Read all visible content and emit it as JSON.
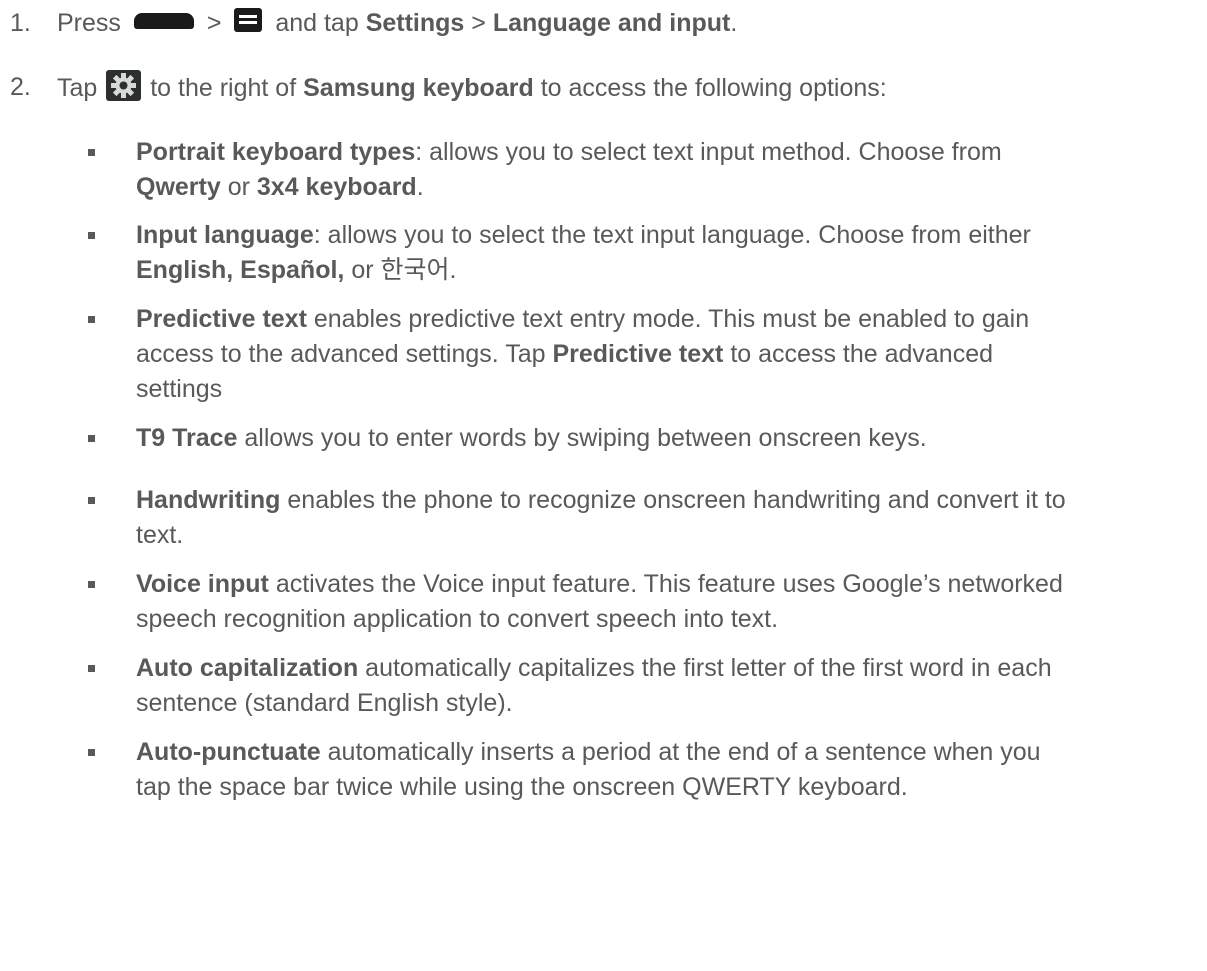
{
  "steps": [
    {
      "number": "1.",
      "pre": "Press",
      "sep": ">",
      "mid": "and tap",
      "b1": "Settings",
      "sep2": ">",
      "b2": "Language and input",
      "end": ".",
      "icons": [
        "home-key-icon",
        "menu-key-icon"
      ]
    },
    {
      "number": "2.",
      "pre": "Tap",
      "mid": "to the right of",
      "b1": "Samsung keyboard",
      "end": "to access the following options:",
      "icons": [
        "settings-gear-icon"
      ]
    }
  ],
  "options": [
    {
      "lines": [
        [
          {
            "b": "Portrait keyboard types"
          },
          {
            "t": ": allows you to select text input method. Choose from"
          }
        ],
        [
          {
            "b": "Qwerty"
          },
          {
            "t": " or "
          },
          {
            "b": "3x4 keyboard"
          },
          {
            "t": "."
          }
        ]
      ]
    },
    {
      "lines": [
        [
          {
            "b": "Input language"
          },
          {
            "t": ": allows you to select the text input language. Choose from either"
          }
        ],
        [
          {
            "b": "English, Español,"
          },
          {
            "t": " or 한국어."
          }
        ]
      ]
    },
    {
      "lines": [
        [
          {
            "b": "Predictive text"
          },
          {
            "t": " enables predictive text entry mode. This must be enabled to gain"
          }
        ],
        [
          {
            "t": "access to the advanced settings. Tap "
          },
          {
            "b": "Predictive text"
          },
          {
            "t": " to access the advanced"
          }
        ],
        [
          {
            "t": "settings"
          }
        ]
      ]
    },
    {
      "lines": [
        [
          {
            "b": "T9 Trace"
          },
          {
            "t": " allows you to enter words by swiping between onscreen keys."
          }
        ]
      ]
    },
    {
      "lines": [
        [
          {
            "b": "Handwriting"
          },
          {
            "t": " enables the phone to recognize onscreen handwriting and convert it to"
          }
        ],
        [
          {
            "t": "text."
          }
        ]
      ]
    },
    {
      "lines": [
        [
          {
            "b": "Voice input"
          },
          {
            "t": " activates the Voice input feature. This feature uses Google’s networked"
          }
        ],
        [
          {
            "t": "speech recognition application to convert speech into text."
          }
        ]
      ]
    },
    {
      "lines": [
        [
          {
            "b": "Auto capitalization"
          },
          {
            "t": " automatically capitalizes the first letter of the first word in each"
          }
        ],
        [
          {
            "t": "sentence (standard English style)."
          }
        ]
      ]
    },
    {
      "lines": [
        [
          {
            "b": "Auto-punctuate"
          },
          {
            "t": " automatically inserts a period at the end of a sentence when you"
          }
        ],
        [
          {
            "t": "tap the space bar twice while using the onscreen QWERTY keyboard."
          }
        ]
      ]
    }
  ]
}
